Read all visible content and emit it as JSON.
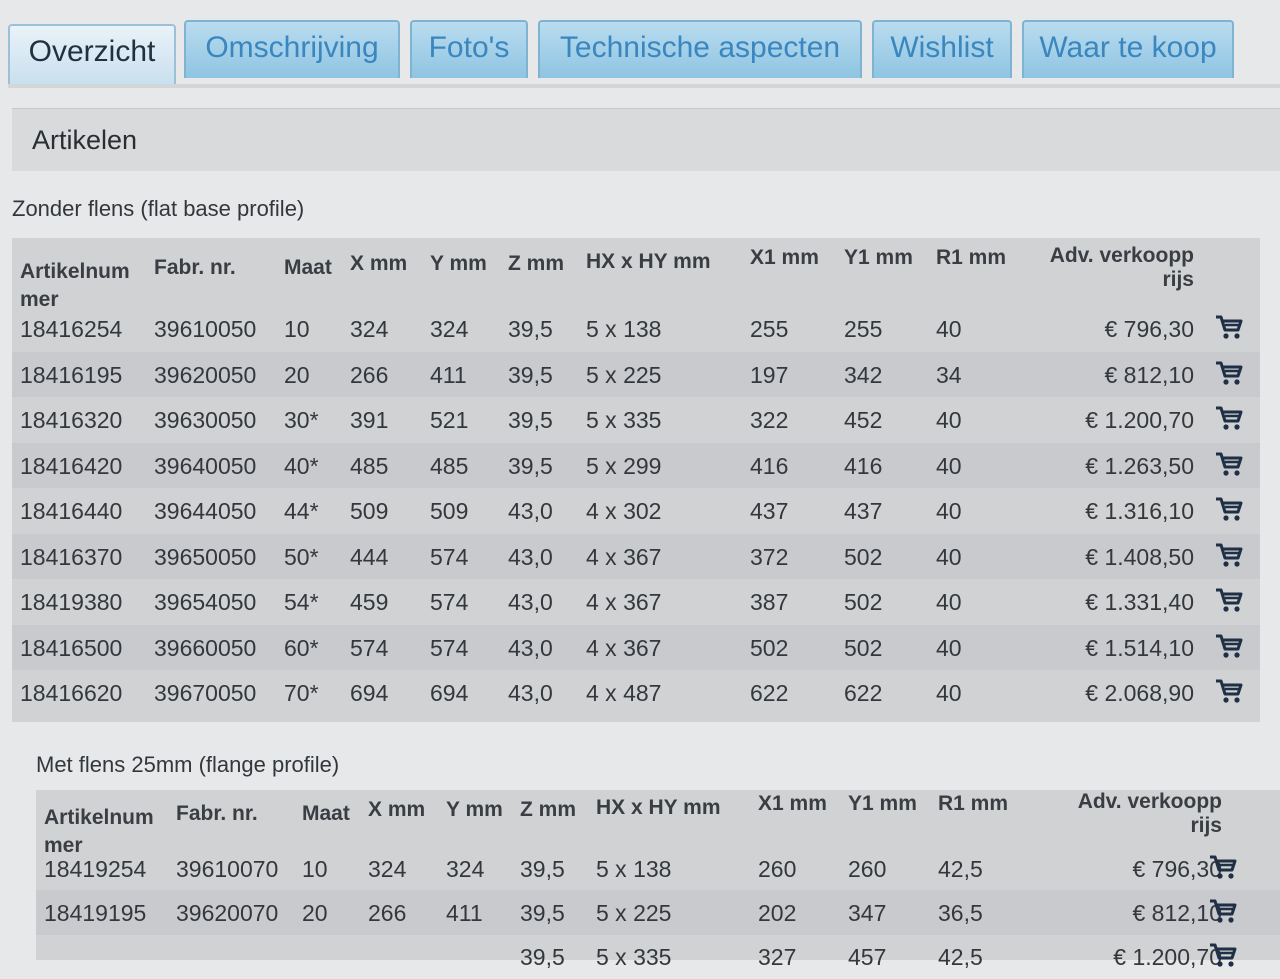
{
  "tabs": [
    "Overzicht",
    "Omschrijving",
    "Foto's",
    "Technische aspecten",
    "Wishlist",
    "Waar te koop"
  ],
  "section_title": "Artikelen",
  "columns": [
    "Artikelnum",
    "mer",
    "Fabr. nr.",
    "Maat",
    "X mm",
    "Y mm",
    "Z mm",
    "HX x HY mm",
    "X1 mm",
    "Y1 mm",
    "R1 mm",
    "Adv. verkoopp",
    "rijs"
  ],
  "table1": {
    "title": "Zonder flens (flat base profile)",
    "rows": [
      [
        "18416254",
        "39610050",
        "10",
        "324",
        "324",
        "39,5",
        "5 x 138",
        "255",
        "255",
        "40",
        "€ 796,30"
      ],
      [
        "18416195",
        "39620050",
        "20",
        "266",
        "411",
        "39,5",
        "5 x 225",
        "197",
        "342",
        "34",
        "€ 812,10"
      ],
      [
        "18416320",
        "39630050",
        "30*",
        "391",
        "521",
        "39,5",
        "5 x 335",
        "322",
        "452",
        "40",
        "€ 1.200,70"
      ],
      [
        "18416420",
        "39640050",
        "40*",
        "485",
        "485",
        "39,5",
        "5 x 299",
        "416",
        "416",
        "40",
        "€ 1.263,50"
      ],
      [
        "18416440",
        "39644050",
        "44*",
        "509",
        "509",
        "43,0",
        "4 x 302",
        "437",
        "437",
        "40",
        "€ 1.316,10"
      ],
      [
        "18416370",
        "39650050",
        "50*",
        "444",
        "574",
        "43,0",
        "4 x 367",
        "372",
        "502",
        "40",
        "€ 1.408,50"
      ],
      [
        "18419380",
        "39654050",
        "54*",
        "459",
        "574",
        "43,0",
        "4 x 367",
        "387",
        "502",
        "40",
        "€ 1.331,40"
      ],
      [
        "18416500",
        "39660050",
        "60*",
        "574",
        "574",
        "43,0",
        "4 x 367",
        "502",
        "502",
        "40",
        "€ 1.514,10"
      ],
      [
        "18416620",
        "39670050",
        "70*",
        "694",
        "694",
        "43,0",
        "4 x 487",
        "622",
        "622",
        "40",
        "€ 2.068,90"
      ]
    ]
  },
  "table2": {
    "title": "Met flens 25mm (flange profile)",
    "rows": [
      [
        "18419254",
        "39610070",
        "10",
        "324",
        "324",
        "39,5",
        "5 x 138",
        "260",
        "260",
        "42,5",
        "€ 796,30"
      ],
      [
        "18419195",
        "39620070",
        "20",
        "266",
        "411",
        "39,5",
        "5 x 225",
        "202",
        "347",
        "36,5",
        "€ 812,10"
      ],
      [
        "",
        "",
        "",
        "",
        "",
        "39,5",
        "5 x 335",
        "327",
        "457",
        "42,5",
        "€ 1.200,70"
      ]
    ]
  },
  "icons": {
    "cart": "shopping-cart-icon"
  },
  "colors": {
    "tab_bg": "#8fc4e2",
    "tab_text": "#3a86bf",
    "cart": "#1f2f45"
  }
}
